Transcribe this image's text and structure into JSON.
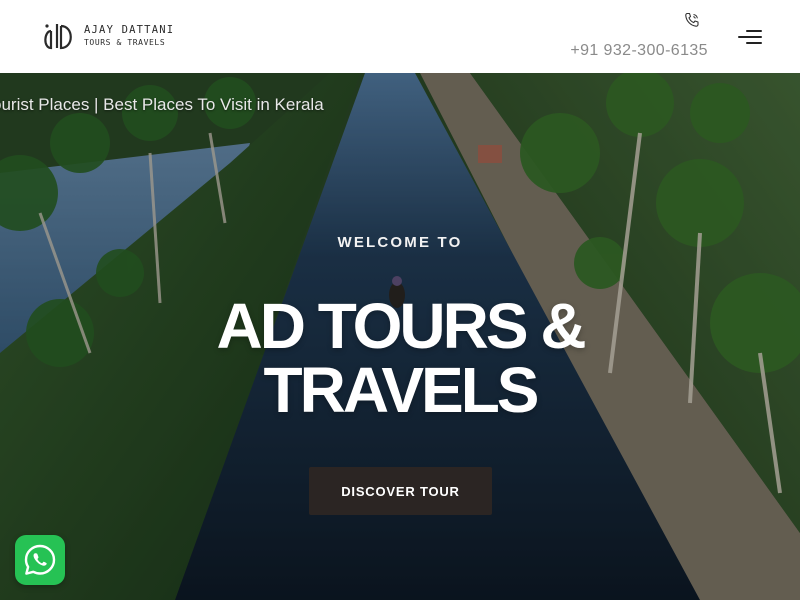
{
  "brand": {
    "name_line1": "AJAY DATTANI",
    "name_line2": "TOURS & TRAVELS",
    "logo_icon": "ad-monogram-logo"
  },
  "header": {
    "phone_icon": "phone-icon",
    "phone_number": "+91 932-300-6135",
    "menu_icon": "hamburger-menu-icon"
  },
  "hero": {
    "video_caption": "ourist Places | Best Places To Visit in Kerala",
    "welcome": "WELCOME TO",
    "title_line1": "AD TOURS &",
    "title_line2": "TRAVELS",
    "cta_label": "DISCOVER TOUR"
  },
  "floating": {
    "whatsapp_icon": "whatsapp-icon"
  },
  "colors": {
    "header_bg": "#ffffff",
    "cta_bg": "#2b2523",
    "whatsapp": "#26c254",
    "phone_text": "#8a8a8a"
  }
}
